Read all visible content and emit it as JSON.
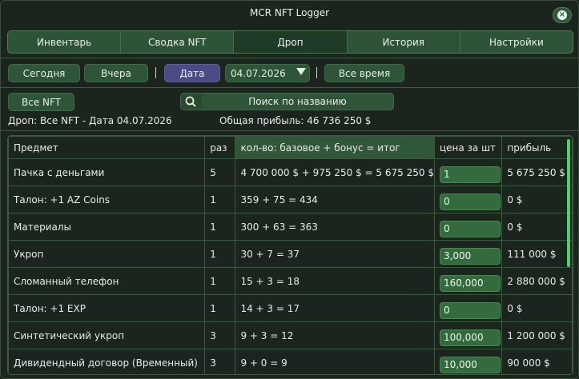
{
  "window": {
    "title": "MCR NFT Logger",
    "close_glyph": "×"
  },
  "tabs": [
    {
      "label": "Инвентарь",
      "active": false
    },
    {
      "label": "Сводка NFT",
      "active": false
    },
    {
      "label": "Дроп",
      "active": true
    },
    {
      "label": "История",
      "active": false
    },
    {
      "label": "Настройки",
      "active": false
    }
  ],
  "filters": {
    "today": "Сегодня",
    "yesterday": "Вчера",
    "date": "Дата",
    "date_value": "04.07.2026",
    "all_time": "Все время",
    "all_nft": "Все NFT",
    "separator": "|"
  },
  "search": {
    "placeholder": "Поиск по названию"
  },
  "summary": {
    "drop_label": "Дроп: Все NFT - Дата 04.07.2026",
    "total_profit": "Общая прибыль: 46 736 250 $"
  },
  "table": {
    "headers": [
      "Предмет",
      "раз",
      "кол-во: базовое + бонус = итог",
      "цена за шт",
      "прибыль"
    ],
    "rows": [
      {
        "item": "Пачка с деньгами",
        "times": "5",
        "qty": "4 700 000 $ + 975 250 $ = 5 675 250 $",
        "price": "1",
        "profit": "5 675 250 $"
      },
      {
        "item": "Талон: +1 AZ Coins",
        "times": "1",
        "qty": "359 + 75 = 434",
        "price": "0",
        "profit": "0 $"
      },
      {
        "item": "Материалы",
        "times": "1",
        "qty": "300 + 63 = 363",
        "price": "0",
        "profit": "0 $"
      },
      {
        "item": "Укроп",
        "times": "1",
        "qty": "30 + 7 = 37",
        "price": "3,000",
        "profit": "111 000 $"
      },
      {
        "item": "Сломанный телефон",
        "times": "1",
        "qty": "15 + 3 = 18",
        "price": "160,000",
        "profit": "2 880 000 $"
      },
      {
        "item": "Талон: +1 EXP",
        "times": "1",
        "qty": "14 + 3 = 17",
        "price": "0",
        "profit": "0 $"
      },
      {
        "item": "Синтетический укроп",
        "times": "3",
        "qty": "9 + 3 = 12",
        "price": "100,000",
        "profit": "1 200 000 $"
      },
      {
        "item": "Дивидендный договор (Временный)",
        "times": "3",
        "qty": "9 + 0 = 9",
        "price": "10,000",
        "profit": "90 000 $"
      }
    ]
  },
  "colors": {
    "accent": "#2e5537",
    "active_filter": "#4b4b86",
    "scrollbar": "#4ed06a"
  }
}
